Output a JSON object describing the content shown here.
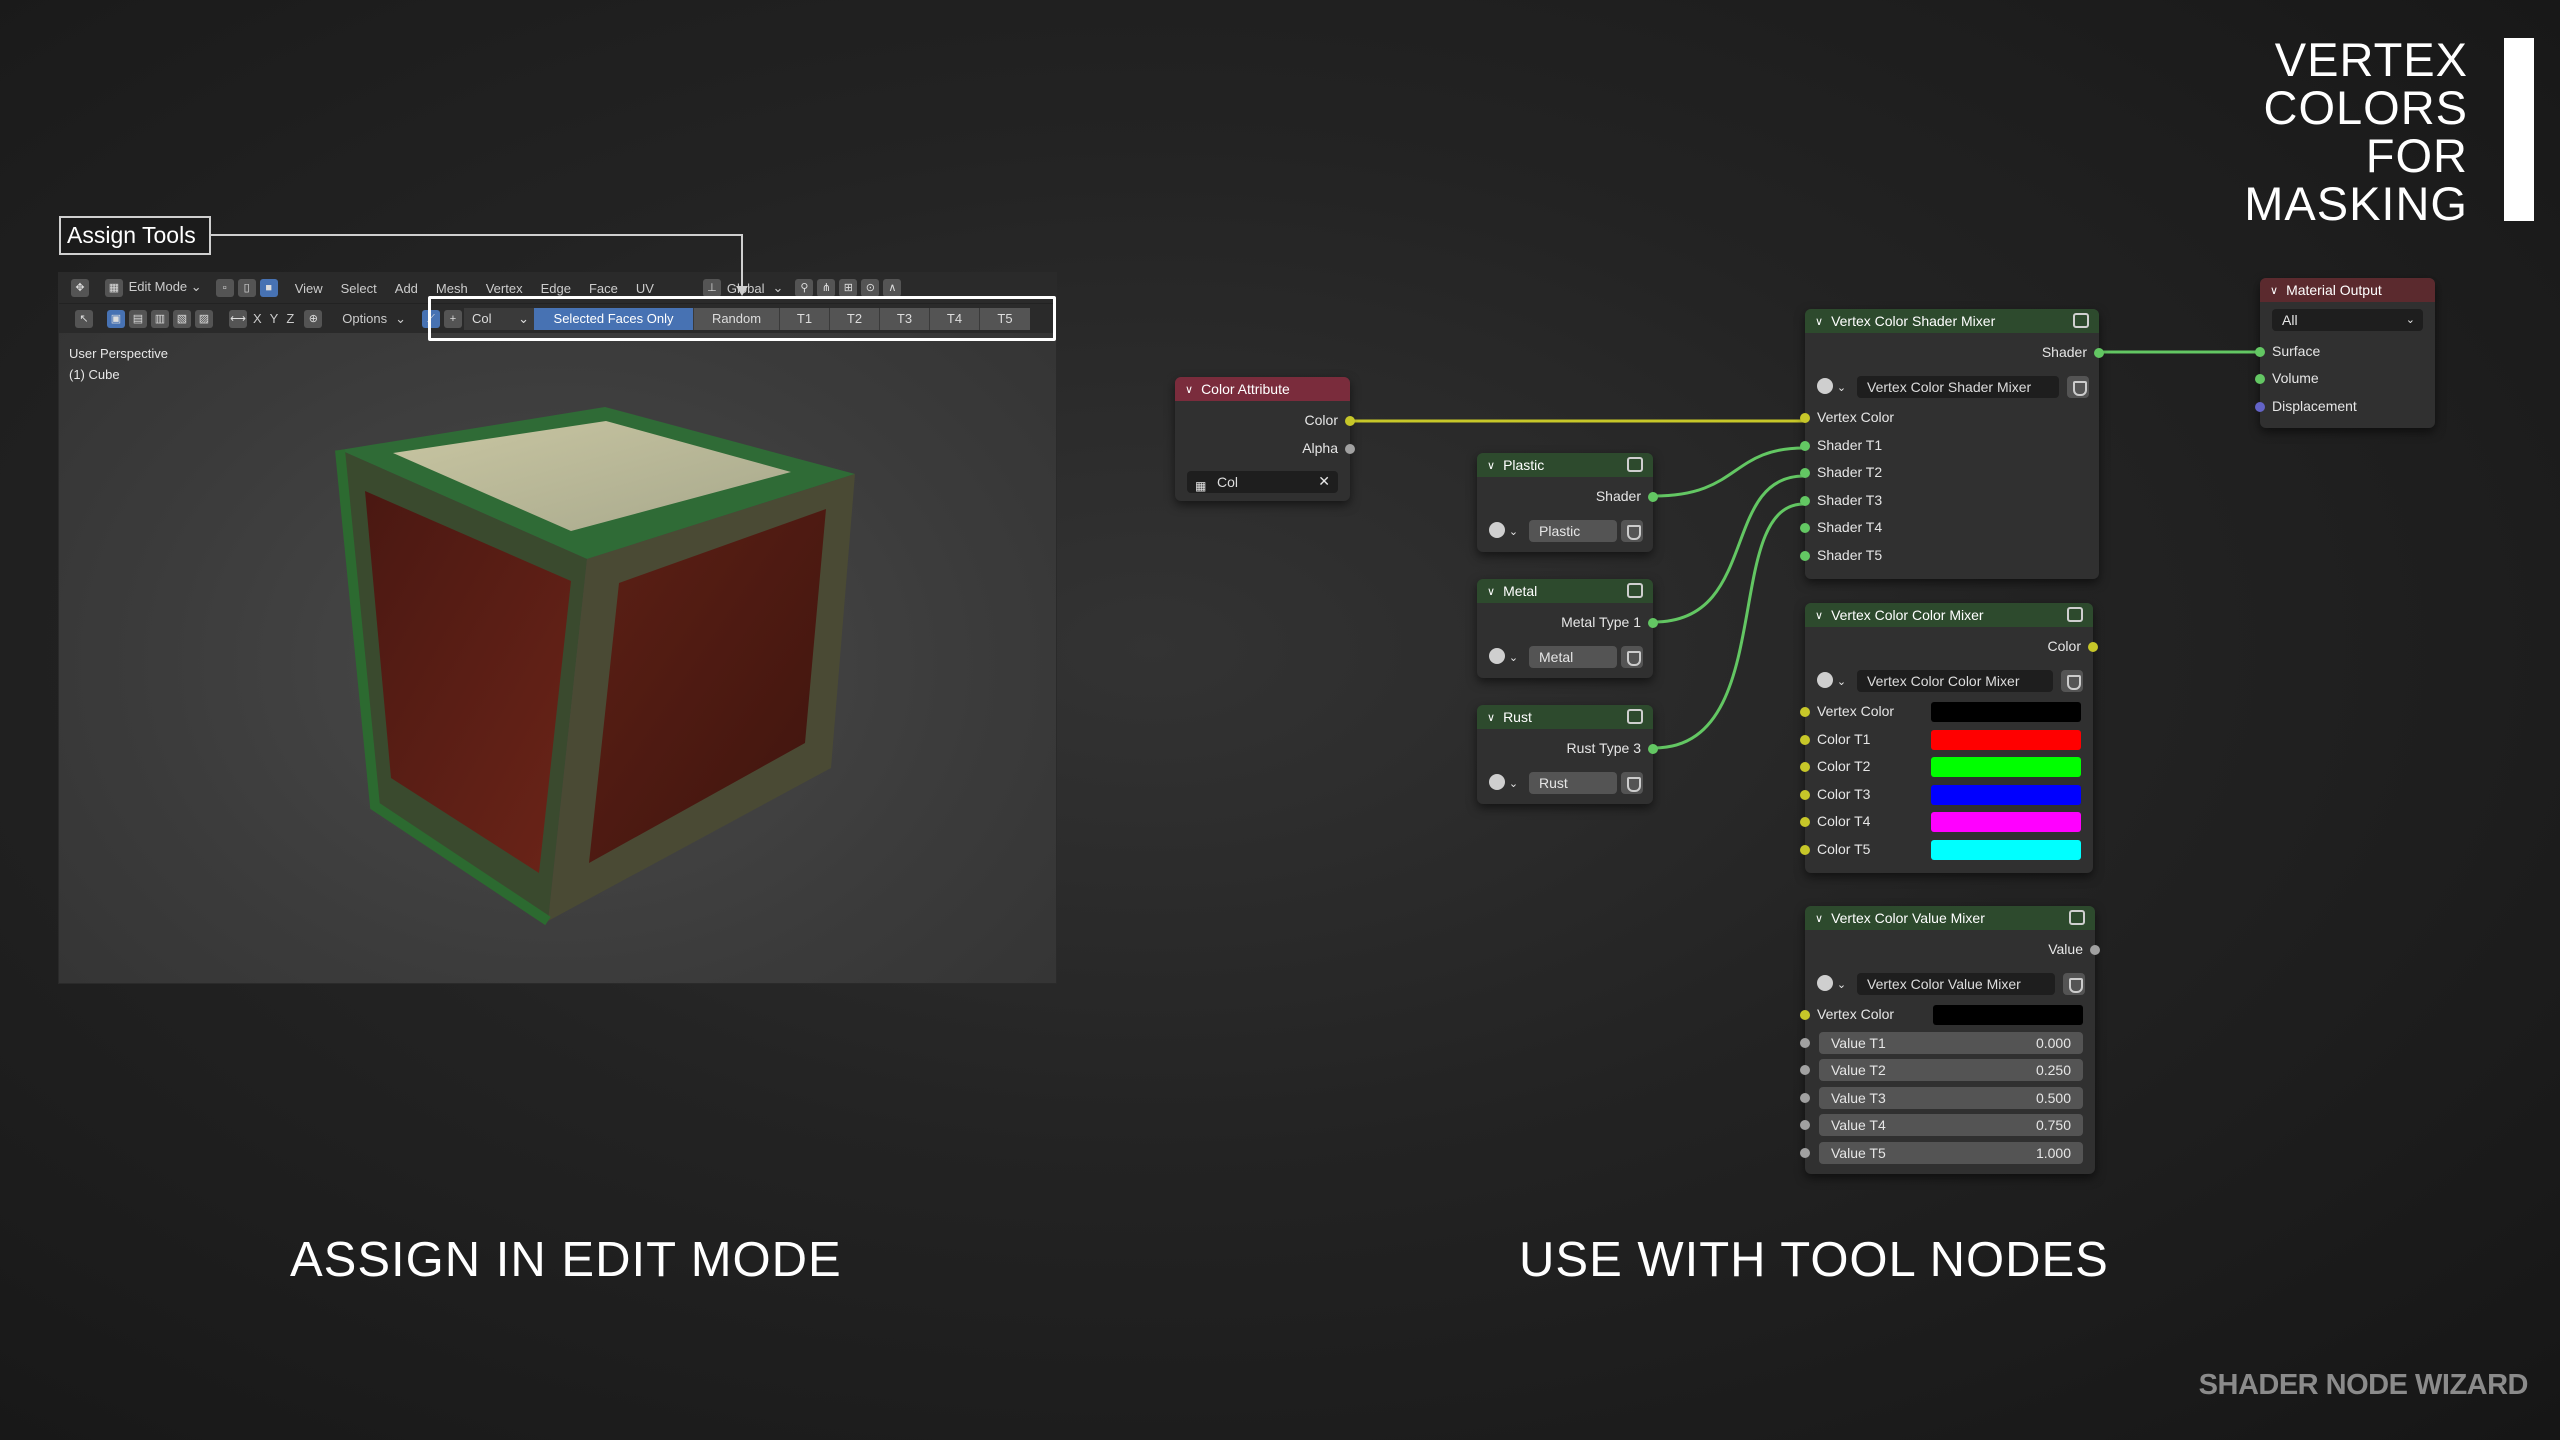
{
  "title": {
    "line1": "VERTEX",
    "line2": "COLORS",
    "line3": "FOR",
    "line4": "MASKING"
  },
  "captions": {
    "left": "ASSIGN IN EDIT MODE",
    "right": "USE WITH TOOL NODES"
  },
  "brand": "SHADER NODE WIZARD",
  "annotation": {
    "label": "Assign Tools"
  },
  "viewport": {
    "mode": "Edit Mode",
    "menu": [
      "View",
      "Select",
      "Add",
      "Mesh",
      "Vertex",
      "Edge",
      "Face",
      "UV"
    ],
    "transform": "Global",
    "axes": [
      "X",
      "Y",
      "Z"
    ],
    "options": "Options",
    "attr": "Col",
    "assign_buttons": [
      "Selected Faces Only",
      "Random",
      "T1",
      "T2",
      "T3",
      "T4",
      "T5"
    ],
    "info_line1": "User Perspective",
    "info_line2": "(1) Cube"
  },
  "nodes": {
    "color_attribute": {
      "title": "Color Attribute",
      "out_color": "Color",
      "out_alpha": "Alpha",
      "field": "Col"
    },
    "plastic": {
      "title": "Plastic",
      "out": "Shader",
      "group": "Plastic"
    },
    "metal": {
      "title": "Metal",
      "out": "Metal Type 1",
      "group": "Metal"
    },
    "rust": {
      "title": "Rust",
      "out": "Rust Type 3",
      "group": "Rust"
    },
    "shader_mixer": {
      "title": "Vertex Color Shader Mixer",
      "out": "Shader",
      "group": "Vertex Color Shader Mixer",
      "inputs": [
        "Vertex Color",
        "Shader T1",
        "Shader T2",
        "Shader T3",
        "Shader T4",
        "Shader T5"
      ]
    },
    "color_mixer": {
      "title": "Vertex Color Color Mixer",
      "out": "Color",
      "group": "Vertex Color Color Mixer",
      "inputs": [
        {
          "label": "Vertex Color",
          "color": "#000000"
        },
        {
          "label": "Color T1",
          "color": "#ff0000"
        },
        {
          "label": "Color T2",
          "color": "#00ff00"
        },
        {
          "label": "Color T3",
          "color": "#0000ff"
        },
        {
          "label": "Color T4",
          "color": "#ff00ff"
        },
        {
          "label": "Color T5",
          "color": "#00ffff"
        }
      ]
    },
    "value_mixer": {
      "title": "Vertex Color Value Mixer",
      "out": "Value",
      "group": "Vertex Color Value Mixer",
      "vertex_color": "Vertex Color",
      "values": [
        {
          "label": "Value T1",
          "value": "0.000"
        },
        {
          "label": "Value T2",
          "value": "0.250"
        },
        {
          "label": "Value T3",
          "value": "0.500"
        },
        {
          "label": "Value T4",
          "value": "0.750"
        },
        {
          "label": "Value T5",
          "value": "1.000"
        }
      ]
    },
    "material_output": {
      "title": "Material Output",
      "target": "All",
      "inputs": [
        "Surface",
        "Volume",
        "Displacement"
      ]
    }
  }
}
